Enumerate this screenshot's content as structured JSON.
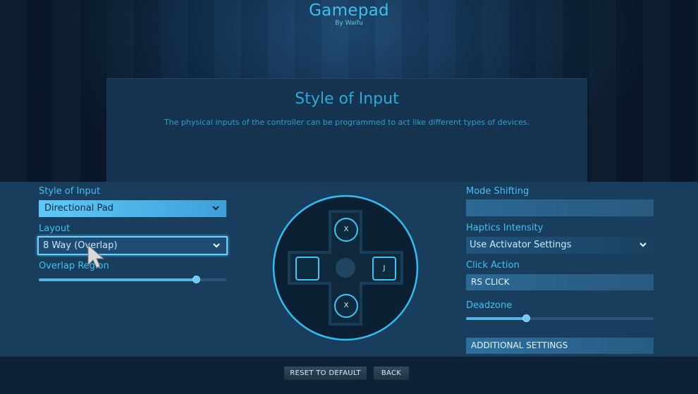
{
  "app": {
    "title": "Gamepad",
    "subtitle": "By Waifu"
  },
  "info": {
    "title": "Style of Input",
    "description": "The physical inputs of the controller can be programmed to act like different types of devices."
  },
  "left": {
    "style_label": "Style of Input",
    "style_value": "Directional Pad",
    "layout_label": "Layout",
    "layout_value": "8 Way (Overlap)",
    "overlap_label": "Overlap Region",
    "overlap_fraction": 0.84
  },
  "dpad": {
    "up_label": "X",
    "down_label": "X",
    "left_label": "",
    "right_label": "J"
  },
  "right": {
    "mode_shifting_label": "Mode Shifting",
    "mode_shifting_value": "",
    "haptics_label": "Haptics Intensity",
    "haptics_value": "Use Activator Settings",
    "click_action_label": "Click Action",
    "click_action_value": "RS CLICK",
    "deadzone_label": "Deadzone",
    "deadzone_fraction": 0.32,
    "additional_label": "ADDITIONAL SETTINGS"
  },
  "footer": {
    "reset_label": "RESET TO DEFAULT",
    "back_label": "BACK"
  },
  "colors": {
    "accent": "#3ec0ee",
    "panel": "#193e5d",
    "select_active": "#5ec9f7"
  }
}
